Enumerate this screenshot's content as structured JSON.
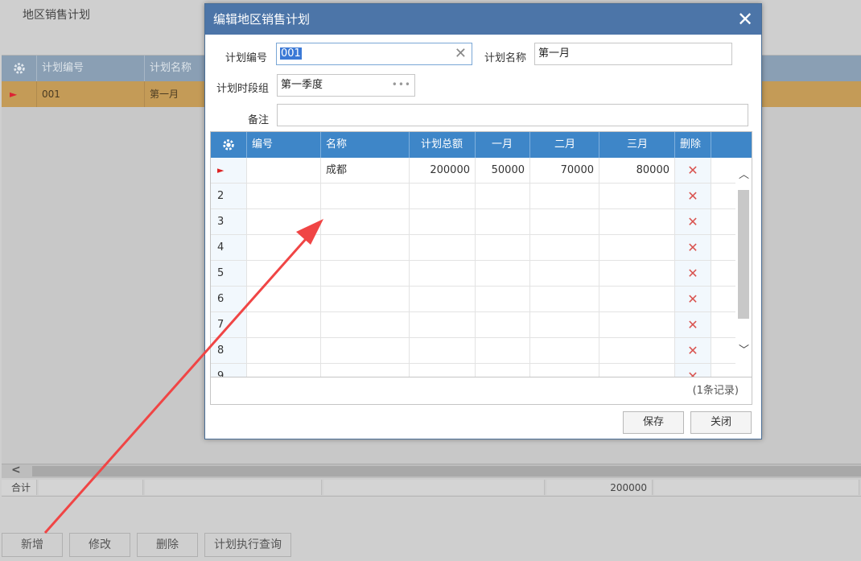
{
  "background": {
    "page_title": "地区销售计划",
    "grid_columns": [
      "计划编号",
      "计划名称"
    ],
    "row": {
      "code": "001",
      "name": "第一月"
    },
    "summary_label": "合计",
    "summary_total": "200000",
    "toolbar": {
      "add": "新增",
      "edit": "修改",
      "delete": "删除",
      "query": "计划执行查询"
    }
  },
  "dialog": {
    "title": "编辑地区销售计划",
    "close_symbol": "✕",
    "form": {
      "plan_code_label": "计划编号",
      "plan_code_value": "001",
      "plan_name_label": "计划名称",
      "plan_name_value": "第一月",
      "period_label": "计划时段组",
      "period_value": "第一季度",
      "remark_label": "备注",
      "remark_value": ""
    },
    "grid": {
      "columns": [
        "编号",
        "名称",
        "计划总额",
        "一月",
        "二月",
        "三月",
        "删除"
      ],
      "rows": [
        {
          "index": "►",
          "code": "",
          "name": "成都",
          "total": "200000",
          "m1": "50000",
          "m2": "70000",
          "m3": "80000"
        },
        {
          "index": "2",
          "code": "",
          "name": "",
          "total": "",
          "m1": "",
          "m2": "",
          "m3": ""
        },
        {
          "index": "3",
          "code": "",
          "name": "",
          "total": "",
          "m1": "",
          "m2": "",
          "m3": ""
        },
        {
          "index": "4",
          "code": "",
          "name": "",
          "total": "",
          "m1": "",
          "m2": "",
          "m3": ""
        },
        {
          "index": "5",
          "code": "",
          "name": "",
          "total": "",
          "m1": "",
          "m2": "",
          "m3": ""
        },
        {
          "index": "6",
          "code": "",
          "name": "",
          "total": "",
          "m1": "",
          "m2": "",
          "m3": ""
        },
        {
          "index": "7",
          "code": "",
          "name": "",
          "total": "",
          "m1": "",
          "m2": "",
          "m3": ""
        },
        {
          "index": "8",
          "code": "",
          "name": "",
          "total": "",
          "m1": "",
          "m2": "",
          "m3": ""
        },
        {
          "index": "9",
          "code": "",
          "name": "",
          "total": "",
          "m1": "",
          "m2": "",
          "m3": ""
        }
      ],
      "delete_symbol": "✕",
      "record_count": "(1条记录)"
    },
    "buttons": {
      "save": "保存",
      "close": "关闭"
    }
  },
  "colors": {
    "header_blue": "#3e86c8",
    "title_blue": "#4c75a8",
    "highlight_row": "#c49b57",
    "annotation_arrow": "#f04545"
  }
}
